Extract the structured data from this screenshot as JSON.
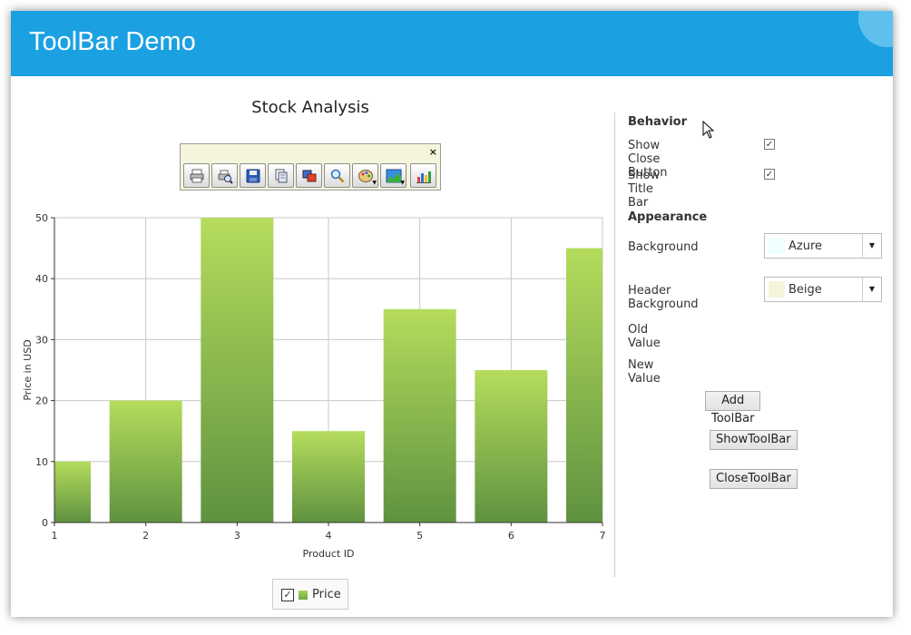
{
  "window": {
    "title": "ToolBar Demo"
  },
  "colors": {
    "accent": "#1ba1e2",
    "bar_top": "#b5dc5c",
    "bar_bottom": "#5f9240",
    "toolbar_bg": "#f5f5dc"
  },
  "toolbar": {
    "close_glyph": "×",
    "buttons": [
      {
        "icon": "print-icon",
        "has_dropdown": false
      },
      {
        "icon": "print-preview-icon",
        "has_dropdown": false
      },
      {
        "icon": "save-icon",
        "has_dropdown": false
      },
      {
        "icon": "copy-icon",
        "has_dropdown": false
      },
      {
        "icon": "copy-image-icon",
        "has_dropdown": false
      },
      {
        "icon": "zoom-icon",
        "has_dropdown": false
      },
      {
        "icon": "palette-icon",
        "has_dropdown": true
      },
      {
        "icon": "chart-type-icon",
        "has_dropdown": true
      },
      {
        "icon": "chart-wizard-icon",
        "has_dropdown": false
      }
    ]
  },
  "chart_data": {
    "type": "bar",
    "title": "Stock Analysis",
    "xlabel": "Product ID",
    "ylabel": "Price in USD",
    "categories": [
      "1",
      "2",
      "3",
      "4",
      "5",
      "6",
      "7"
    ],
    "series": [
      {
        "name": "Price",
        "values": [
          10,
          20,
          50,
          15,
          35,
          25,
          45
        ]
      }
    ],
    "ylim": [
      0,
      50
    ],
    "yticks": [
      "0",
      "10",
      "20",
      "30",
      "40",
      "50"
    ],
    "grid": true,
    "legend": "bottom"
  },
  "legend": {
    "checked_glyph": "✓",
    "label": "Price"
  },
  "panel": {
    "behavior_header": "Behavior",
    "show_close_button_label": "Show Close Button",
    "show_close_button_checked": "✓",
    "show_title_bar_label": "Show Title Bar",
    "show_title_bar_checked": "✓",
    "appearance_header": "Appearance",
    "background_label": "Background",
    "background_value": "Azure",
    "background_color": "#f0ffff",
    "header_background_label": "Header Background",
    "header_background_value": "Beige",
    "header_background_color": "#f5f5dc",
    "dropdown_glyph": "▼",
    "old_value_label": "Old Value",
    "new_value_label": "New Value",
    "add_button": "Add ToolBar Item",
    "show_button": "ShowToolBar",
    "close_button": "CloseToolBar"
  }
}
